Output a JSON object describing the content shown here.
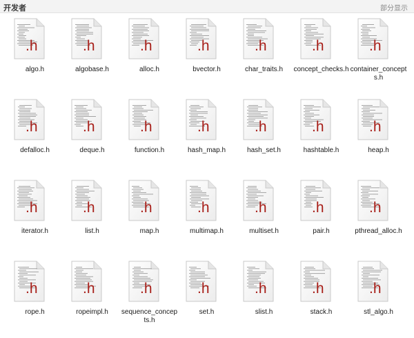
{
  "header": {
    "title": "开发者",
    "toggle_label": "部分显示"
  },
  "icon_ext_label": ".h",
  "colors": {
    "ext_red": "#a8201a"
  },
  "files": [
    {
      "name": "algo.h"
    },
    {
      "name": "algobase.h"
    },
    {
      "name": "alloc.h"
    },
    {
      "name": "bvector.h"
    },
    {
      "name": "char_traits.h"
    },
    {
      "name": "concept_checks.h"
    },
    {
      "name": "container_concepts.h"
    },
    {
      "name": "defalloc.h"
    },
    {
      "name": "deque.h"
    },
    {
      "name": "function.h"
    },
    {
      "name": "hash_map.h"
    },
    {
      "name": "hash_set.h"
    },
    {
      "name": "hashtable.h"
    },
    {
      "name": "heap.h"
    },
    {
      "name": "iterator.h"
    },
    {
      "name": "list.h"
    },
    {
      "name": "map.h"
    },
    {
      "name": "multimap.h"
    },
    {
      "name": "multiset.h"
    },
    {
      "name": "pair.h"
    },
    {
      "name": "pthread_alloc.h"
    },
    {
      "name": "rope.h"
    },
    {
      "name": "ropeimpl.h"
    },
    {
      "name": "sequence_concepts.h"
    },
    {
      "name": "set.h"
    },
    {
      "name": "slist.h"
    },
    {
      "name": "stack.h"
    },
    {
      "name": "stl_algo.h"
    }
  ]
}
